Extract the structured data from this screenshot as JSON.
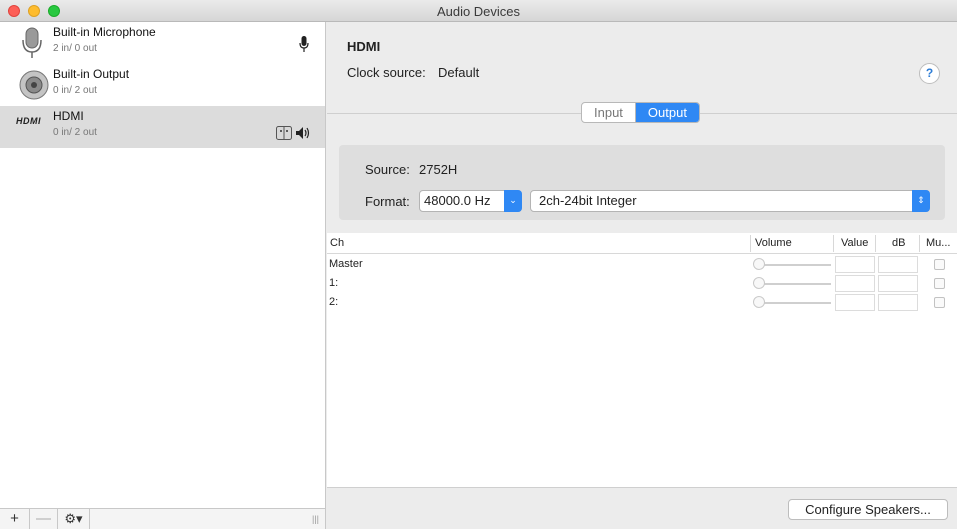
{
  "window": {
    "title": "Audio Devices"
  },
  "devices": [
    {
      "name": "Built-in Microphone",
      "io": "2 in/ 0 out",
      "icon": "microphone-icon"
    },
    {
      "name": "Built-in Output",
      "io": "0 in/ 2 out",
      "icon": "speaker-icon"
    },
    {
      "name": "HDMI",
      "io": "0 in/ 2 out",
      "icon": "hdmi-icon",
      "logo_text": "HDMI"
    }
  ],
  "sidebar_toolbar": {
    "add": "+",
    "remove": "—",
    "actions": "⚙▾"
  },
  "detail": {
    "device_name": "HDMI",
    "clock_label": "Clock source:",
    "clock_value": "Default",
    "help": "?",
    "tabs": [
      "Input",
      "Output"
    ],
    "active_tab": "Output",
    "source_label": "Source:",
    "source_value": "2752H",
    "format_label": "Format:",
    "sample_rate": "48000.0 Hz",
    "bit_format": "2ch-24bit Integer"
  },
  "table": {
    "headers": {
      "ch": "Ch",
      "volume": "Volume",
      "value": "Value",
      "db": "dB",
      "mute": "Mu..."
    },
    "rows": [
      {
        "ch": "Master"
      },
      {
        "ch": "1:"
      },
      {
        "ch": "2:"
      }
    ]
  },
  "configure_button": "Configure Speakers..."
}
